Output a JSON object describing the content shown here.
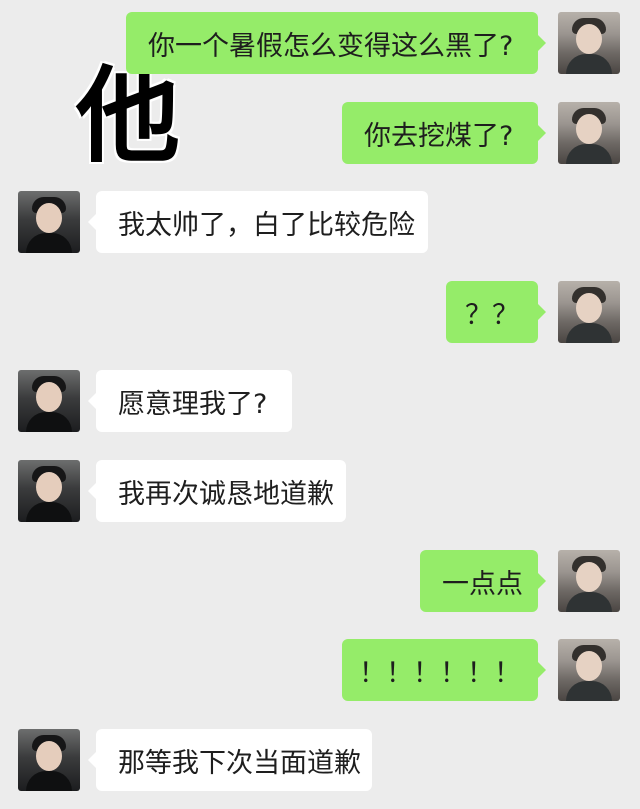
{
  "watermark": "他",
  "messages": [
    {
      "side": "right",
      "text": "你一个暑假怎么变得这么黑了?"
    },
    {
      "side": "right",
      "text": "你去挖煤了?"
    },
    {
      "side": "left",
      "text": "我太帅了，白了比较危险"
    },
    {
      "side": "right",
      "text": "？？"
    },
    {
      "side": "left",
      "text": "愿意理我了?"
    },
    {
      "side": "left",
      "text": "我再次诚恳地道歉"
    },
    {
      "side": "right",
      "text": "一点点"
    },
    {
      "side": "right",
      "text": "！！！！！！"
    },
    {
      "side": "left",
      "text": "那等我下次当面道歉"
    }
  ]
}
